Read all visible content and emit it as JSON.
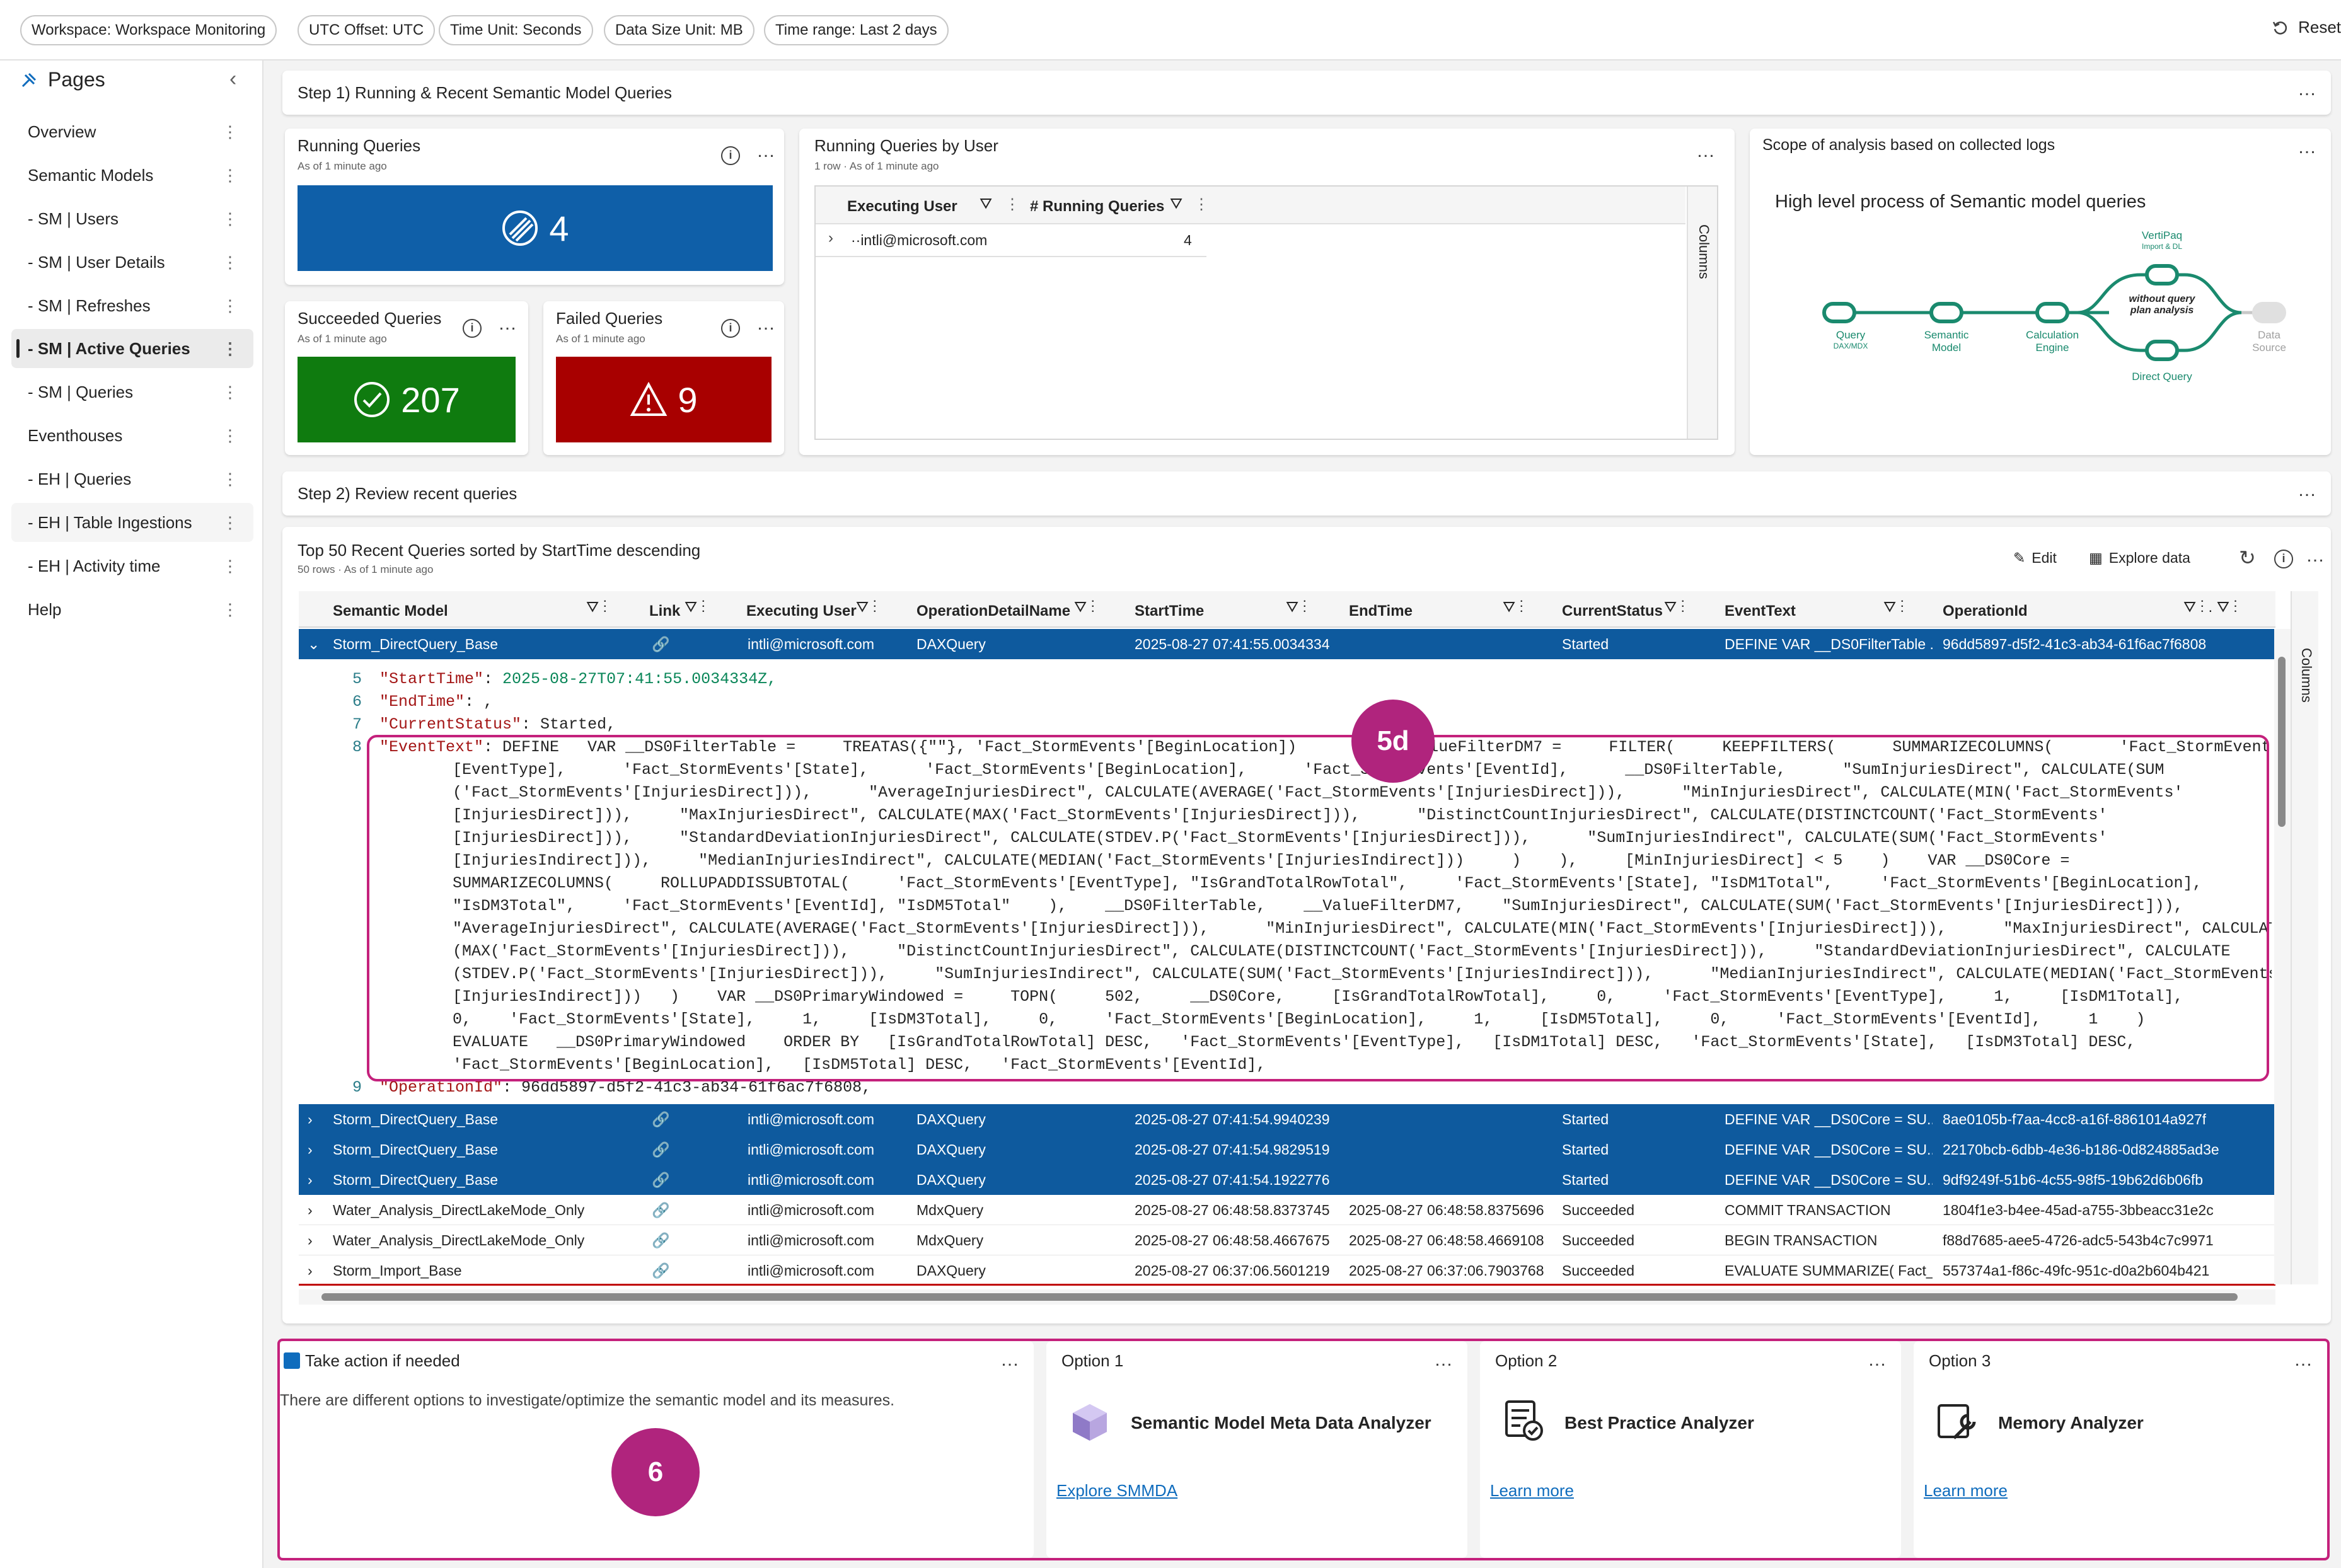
{
  "filters": [
    "Workspace: Workspace Monitoring",
    "UTC Offset: UTC",
    "Time Unit: Seconds",
    "Data Size Unit: MB",
    "Time range: Last 2 days"
  ],
  "reset_label": "Reset",
  "sidebar": {
    "title": "Pages",
    "items": [
      {
        "label": "Overview"
      },
      {
        "label": "Semantic Models"
      },
      {
        "label": "- SM | Users"
      },
      {
        "label": "- SM | User Details"
      },
      {
        "label": "- SM | Refreshes"
      },
      {
        "label": "- SM | Active Queries"
      },
      {
        "label": "- SM | Queries"
      },
      {
        "label": "Eventhouses"
      },
      {
        "label": "- EH | Queries"
      },
      {
        "label": "- EH | Table Ingestions"
      },
      {
        "label": "- EH | Activity time"
      },
      {
        "label": "Help"
      }
    ]
  },
  "step1": {
    "title": "Step 1) Running & Recent Semantic Model Queries"
  },
  "running": {
    "title": "Running Queries",
    "sub": "As of 1 minute ago",
    "value": "4",
    "color": "#0f5fa8"
  },
  "succeeded": {
    "title": "Succeeded Queries",
    "sub": "As of 1 minute ago",
    "value": "207",
    "color": "#0f7b0f"
  },
  "failed": {
    "title": "Failed Queries",
    "sub": "As of 1 minute ago",
    "value": "9",
    "color": "#a80000"
  },
  "by_user": {
    "title": "Running Queries by User",
    "sub": "1 row · As of 1 minute ago",
    "col1": "Executing User",
    "col2": "# Running Queries",
    "columns_label": "Columns",
    "row_user": "··intli@microsoft.com",
    "row_value": "4"
  },
  "scope": {
    "title": "Scope of analysis based on collected logs",
    "subtitle": "High level process of Semantic model queries",
    "nodes": {
      "query": "Query",
      "query_sub": "DAX/MDX",
      "sm": "Semantic",
      "sm2": "Model",
      "calc": "Calculation",
      "calc2": "Engine",
      "vertipaq": "VertiPaq",
      "vertipaq_sub": "Import & DL",
      "without1": "without query",
      "without2": "plan analysis",
      "dq": "Direct Query",
      "ds": "Data",
      "ds2": "Source"
    }
  },
  "step2": {
    "title": "Step 2) Review recent queries"
  },
  "recent": {
    "title": "Top 50 Recent Queries sorted by StartTime descending",
    "sub": "50 rows · As of 1 minute ago",
    "edit_label": "Edit",
    "explore_label": "Explore data",
    "columns_label": "Columns",
    "headers": [
      "Semantic Model",
      "Link",
      "Executing User",
      "OperationDetailName",
      "StartTime",
      "EndTime",
      "CurrentStatus",
      "EventText",
      "OperationId"
    ],
    "expanded_row": {
      "model": "Storm_DirectQuery_Base",
      "user": "intli@microsoft.com",
      "op": "DAXQuery",
      "start": "2025-08-27 07:41:55.0034334",
      "end": "",
      "status": "Started",
      "text": "DEFINE VAR __DS0FilterTable ...",
      "id": "96dd5897-d5f2-41c3-ab34-61f6ac7f6808"
    },
    "rows": [
      {
        "model": "Storm_DirectQuery_Base",
        "user": "intli@microsoft.com",
        "op": "DAXQuery",
        "start": "2025-08-27 07:41:54.9940239",
        "end": "",
        "status": "Started",
        "text": "DEFINE VAR __DS0Core = SU...",
        "id": "8ae0105b-f7aa-4cc8-a16f-8861014a927f",
        "sel": true
      },
      {
        "model": "Storm_DirectQuery_Base",
        "user": "intli@microsoft.com",
        "op": "DAXQuery",
        "start": "2025-08-27 07:41:54.9829519",
        "end": "",
        "status": "Started",
        "text": "DEFINE VAR __DS0Core = SU...",
        "id": "22170bcb-6dbb-4e36-b186-0d824885ad3e",
        "sel": true
      },
      {
        "model": "Storm_DirectQuery_Base",
        "user": "intli@microsoft.com",
        "op": "DAXQuery",
        "start": "2025-08-27 07:41:54.1922776",
        "end": "",
        "status": "Started",
        "text": "DEFINE VAR __DS0Core = SU...",
        "id": "9df9249f-51b6-4c55-98f5-19b62d6b06fb",
        "sel": true
      },
      {
        "model": "Water_Analysis_DirectLakeMode_Only",
        "user": "intli@microsoft.com",
        "op": "MdxQuery",
        "start": "2025-08-27 06:48:58.8373745",
        "end": "2025-08-27 06:48:58.8375696",
        "status": "Succeeded",
        "text": "COMMIT TRANSACTION",
        "id": "1804f1e3-b4ee-45ad-a755-3bbeacc31e2c",
        "sel": false
      },
      {
        "model": "Water_Analysis_DirectLakeMode_Only",
        "user": "intli@microsoft.com",
        "op": "MdxQuery",
        "start": "2025-08-27 06:48:58.4667675",
        "end": "2025-08-27 06:48:58.4669108",
        "status": "Succeeded",
        "text": "BEGIN TRANSACTION",
        "id": "f88d7685-aee5-4726-adc5-543b4c7c9971",
        "sel": false
      },
      {
        "model": "Storm_Import_Base",
        "user": "intli@microsoft.com",
        "op": "DAXQuery",
        "start": "2025-08-27 06:37:06.5601219",
        "end": "2025-08-27 06:37:06.7903768",
        "status": "Succeeded",
        "text": "EVALUATE SUMMARIZE( Fact_...",
        "id": "557374a1-f86c-49fc-951c-d0a2b604b421",
        "sel": false
      }
    ],
    "code": {
      "l5_key": "\"StartTime\"",
      "l5_val": "2025-08-27T07:41:55.0034334Z,",
      "l6_key": "\"EndTime\"",
      "l6_val": ": ,",
      "l7_key": "\"CurrentStatus\"",
      "l7_val": ": Started,",
      "l8_key": "\"EventText\"",
      "l8_lines": [
        ": DEFINE   VAR __DS0FilterTable =     TREATAS({\"\"}, 'Fact_StormEvents'[BeginLocation])      VAR __ValueFilterDM7 =     FILTER(     KEEPFILTERS(      SUMMARIZECOLUMNS(       'Fact_StormEvents'",
        "[EventType],      'Fact_StormEvents'[State],      'Fact_StormEvents'[BeginLocation],      'Fact_StormEvents'[EventId],      __DS0FilterTable,      \"SumInjuriesDirect\", CALCULATE(SUM",
        "('Fact_StormEvents'[InjuriesDirect])),      \"AverageInjuriesDirect\", CALCULATE(AVERAGE('Fact_StormEvents'[InjuriesDirect])),      \"MinInjuriesDirect\", CALCULATE(MIN('Fact_StormEvents'",
        "[InjuriesDirect])),     \"MaxInjuriesDirect\", CALCULATE(MAX('Fact_StormEvents'[InjuriesDirect])),      \"DistinctCountInjuriesDirect\", CALCULATE(DISTINCTCOUNT('Fact_StormEvents'",
        "[InjuriesDirect])),     \"StandardDeviationInjuriesDirect\", CALCULATE(STDEV.P('Fact_StormEvents'[InjuriesDirect])),      \"SumInjuriesIndirect\", CALCULATE(SUM('Fact_StormEvents'",
        "[InjuriesIndirect])),     \"MedianInjuriesIndirect\", CALCULATE(MEDIAN('Fact_StormEvents'[InjuriesIndirect]))     )    ),     [MinInjuriesDirect] < 5    )    VAR __DS0Core =",
        "SUMMARIZECOLUMNS(     ROLLUPADDISSUBTOTAL(     'Fact_StormEvents'[EventType], \"IsGrandTotalRowTotal\",     'Fact_StormEvents'[State], \"IsDM1Total\",     'Fact_StormEvents'[BeginLocation],",
        "\"IsDM3Total\",     'Fact_StormEvents'[EventId], \"IsDM5Total\"    ),    __DS0FilterTable,    __ValueFilterDM7,    \"SumInjuriesDirect\", CALCULATE(SUM('Fact_StormEvents'[InjuriesDirect])),",
        "\"AverageInjuriesDirect\", CALCULATE(AVERAGE('Fact_StormEvents'[InjuriesDirect])),      \"MinInjuriesDirect\", CALCULATE(MIN('Fact_StormEvents'[InjuriesDirect])),      \"MaxInjuriesDirect\", CALCULATE",
        "(MAX('Fact_StormEvents'[InjuriesDirect])),     \"DistinctCountInjuriesDirect\", CALCULATE(DISTINCTCOUNT('Fact_StormEvents'[InjuriesDirect])),     \"StandardDeviationInjuriesDirect\", CALCULATE",
        "(STDEV.P('Fact_StormEvents'[InjuriesDirect])),     \"SumInjuriesIndirect\", CALCULATE(SUM('Fact_StormEvents'[InjuriesIndirect])),      \"MedianInjuriesIndirect\", CALCULATE(MEDIAN('Fact_StormEvents'",
        "[InjuriesIndirect]))   )    VAR __DS0PrimaryWindowed =     TOPN(     502,     __DS0Core,     [IsGrandTotalRowTotal],     0,     'Fact_StormEvents'[EventType],     1,     [IsDM1Total],",
        "0,    'Fact_StormEvents'[State],     1,     [IsDM3Total],     0,     'Fact_StormEvents'[BeginLocation],     1,     [IsDM5Total],     0,     'Fact_StormEvents'[EventId],     1    )",
        "EVALUATE   __DS0PrimaryWindowed    ORDER BY   [IsGrandTotalRowTotal] DESC,   'Fact_StormEvents'[EventType],   [IsDM1Total] DESC,   'Fact_StormEvents'[State],   [IsDM3Total] DESC,",
        "'Fact_StormEvents'[BeginLocation],   [IsDM5Total] DESC,   'Fact_StormEvents'[EventId],"
      ],
      "l9_key": "\"OperationId\"",
      "l9_val": ": 96dd5897-d5f2-41c3-ab34-61f6ac7f6808,"
    }
  },
  "callouts": {
    "c5d": "5d",
    "c6": "6"
  },
  "action": {
    "title": "Take action if needed",
    "text": "There are different options to investigate/optimize the semantic model and its measures."
  },
  "options": [
    {
      "title": "Option 1",
      "name": "Semantic Model Meta Data Analyzer",
      "link": "Explore SMMDA"
    },
    {
      "title": "Option 2",
      "name": "Best Practice Analyzer",
      "link": "Learn more"
    },
    {
      "title": "Option 3",
      "name": "Memory Analyzer",
      "link": "Learn more"
    }
  ],
  "colors": {
    "accent": "#0f5fa8",
    "highlight": "#c4217c",
    "flow": "#1a8a6e"
  }
}
